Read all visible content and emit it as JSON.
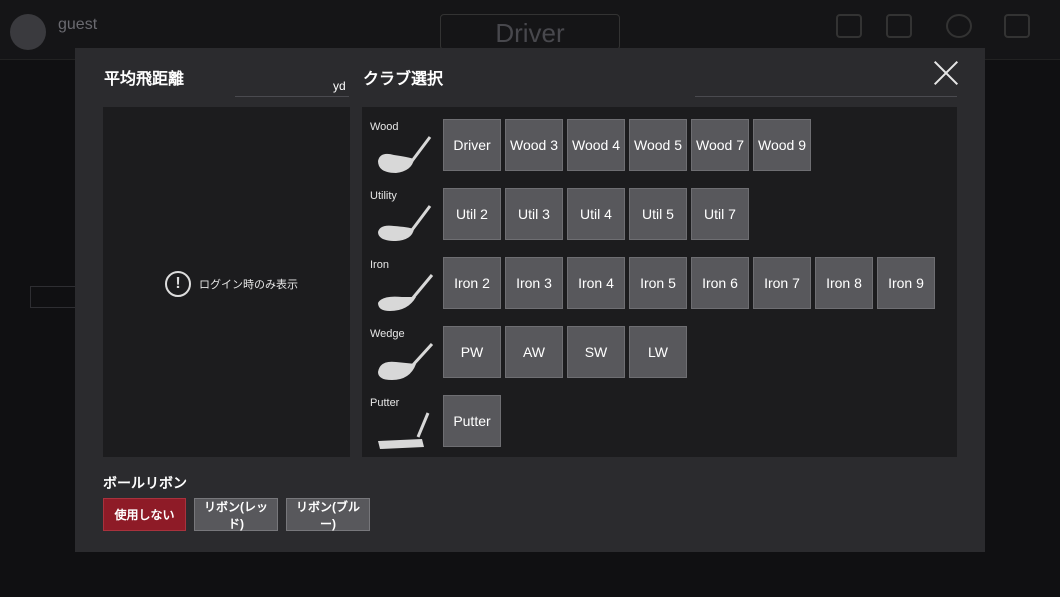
{
  "background": {
    "user_name": "guest",
    "club_title": "Driver"
  },
  "modal": {
    "left_title": "平均飛距離",
    "distance_unit": "yd",
    "right_title": "クラブ選択",
    "login_note": "ログイン時のみ表示",
    "info_icon": "exclamation-circle-icon",
    "close_icon": "close-icon"
  },
  "clubs": [
    {
      "category": "Wood",
      "icon": "wood-club-icon",
      "buttons": [
        "Driver",
        "Wood 3",
        "Wood 4",
        "Wood 5",
        "Wood 7",
        "Wood 9"
      ]
    },
    {
      "category": "Utility",
      "icon": "utility-club-icon",
      "buttons": [
        "Util 2",
        "Util 3",
        "Util 4",
        "Util 5",
        "Util 7"
      ]
    },
    {
      "category": "Iron",
      "icon": "iron-club-icon",
      "buttons": [
        "Iron 2",
        "Iron 3",
        "Iron 4",
        "Iron 5",
        "Iron 6",
        "Iron 7",
        "Iron 8",
        "Iron 9"
      ]
    },
    {
      "category": "Wedge",
      "icon": "wedge-club-icon",
      "buttons": [
        "PW",
        "AW",
        "SW",
        "LW"
      ]
    },
    {
      "category": "Putter",
      "icon": "putter-club-icon",
      "buttons": [
        "Putter"
      ]
    }
  ],
  "ribbon": {
    "title": "ボールリボン",
    "options": [
      {
        "label": "使用しない",
        "active": true
      },
      {
        "label": "リボン(レッド)",
        "active": false
      },
      {
        "label": "リボン(ブルー)",
        "active": false
      }
    ]
  },
  "colors": {
    "active_ribbon": "#8e1b27",
    "club_button": "#58585c",
    "panel": "#1c1c1e",
    "modal": "#2b2b2e"
  }
}
